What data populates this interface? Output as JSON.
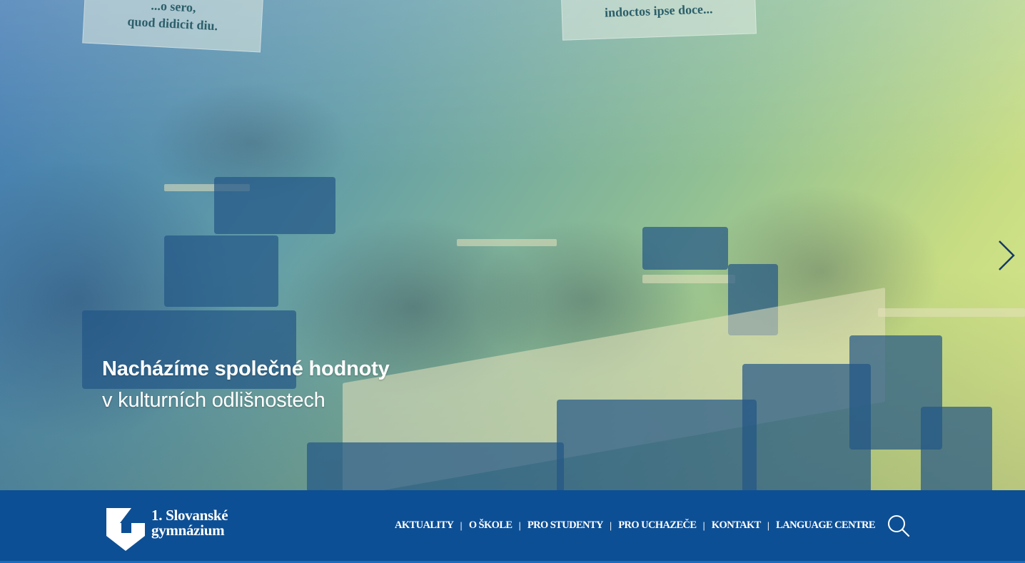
{
  "hero": {
    "poster_left_text": "...o sero,\nquod didicit diu.",
    "poster_right_text": "indoctos ipse doce...",
    "headline": "Nacházíme společné hodnoty",
    "subheadline": "v kulturních odlišnostech",
    "next_icon": "chevron-right-icon"
  },
  "header": {
    "logo_line1": "1. Slovanské",
    "logo_line2": "gymnázium",
    "logo_icon": "shield-logo-icon",
    "nav": [
      {
        "label": "AKTUALITY"
      },
      {
        "label": "O ŠKOLE"
      },
      {
        "label": "PRO STUDENTY"
      },
      {
        "label": "PRO UCHAZEČE"
      },
      {
        "label": "KONTAKT"
      },
      {
        "label": "LANGUAGE CENTRE"
      }
    ],
    "separator": "|",
    "search_icon": "search-icon"
  },
  "colors": {
    "navbar_bg": "#0d4f94",
    "accent_border": "#1a6bbf",
    "text": "#ffffff"
  }
}
